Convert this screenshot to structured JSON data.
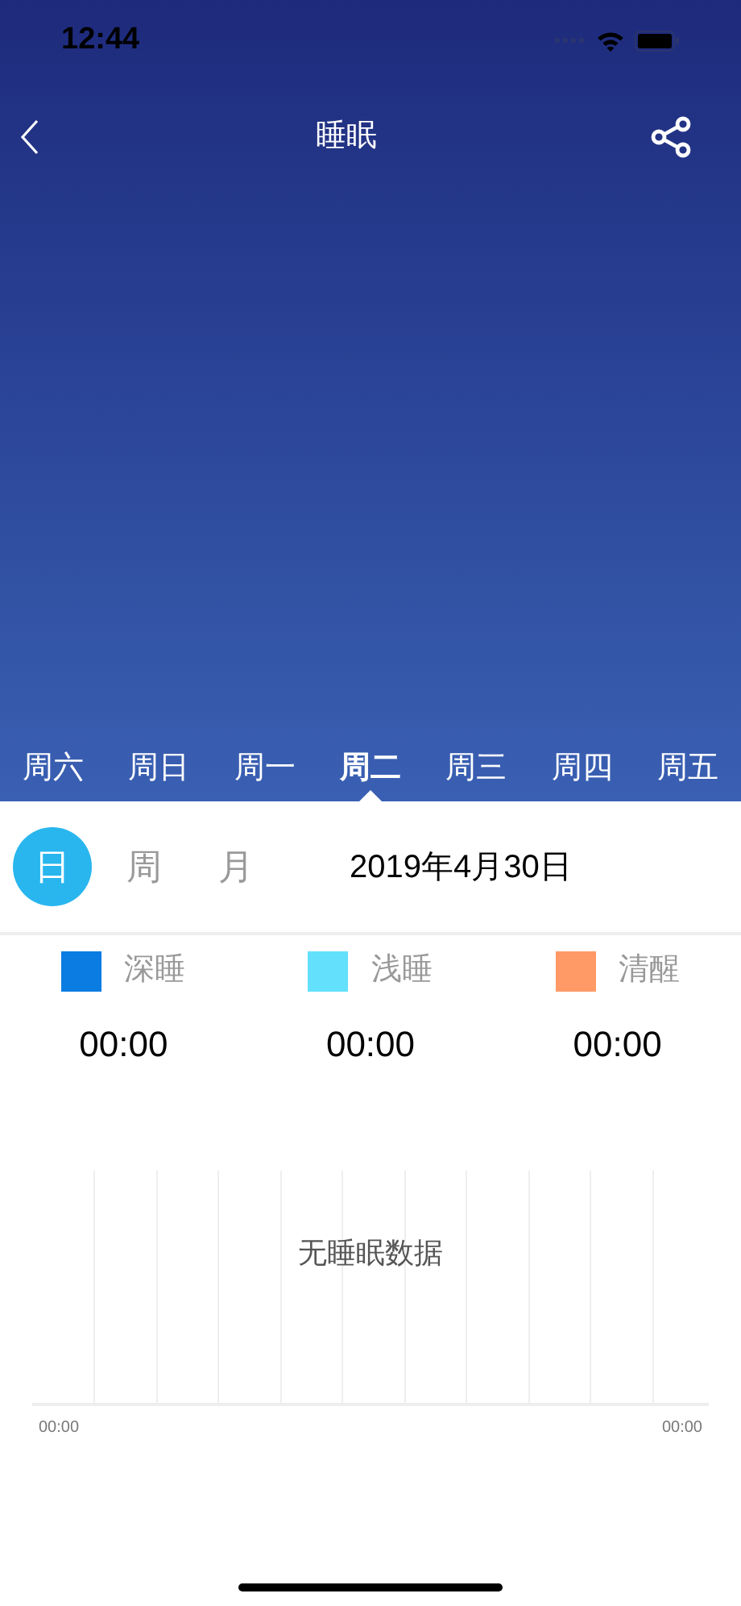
{
  "status_bar": {
    "time": "12:44"
  },
  "nav_bar": {
    "title": "睡眠"
  },
  "week_tabs": [
    {
      "label": "周六",
      "selected": false
    },
    {
      "label": "周日",
      "selected": false
    },
    {
      "label": "周一",
      "selected": false
    },
    {
      "label": "周二",
      "selected": true
    },
    {
      "label": "周三",
      "selected": false
    },
    {
      "label": "周四",
      "selected": false
    },
    {
      "label": "周五",
      "selected": false
    }
  ],
  "period_tabs": [
    {
      "label": "日",
      "selected": true
    },
    {
      "label": "周",
      "selected": false
    },
    {
      "label": "月",
      "selected": false
    }
  ],
  "date": "2019年4月30日",
  "legend": [
    {
      "label": "深睡",
      "color": "#0a7ce2",
      "duration": "00:00"
    },
    {
      "label": "浅睡",
      "color": "#62e0fc",
      "duration": "00:00"
    },
    {
      "label": "清醒",
      "color": "#ff9966",
      "duration": "00:00"
    }
  ],
  "chart": {
    "empty_message": "无睡眠数据",
    "x_start": "00:00",
    "x_end": "00:00"
  }
}
